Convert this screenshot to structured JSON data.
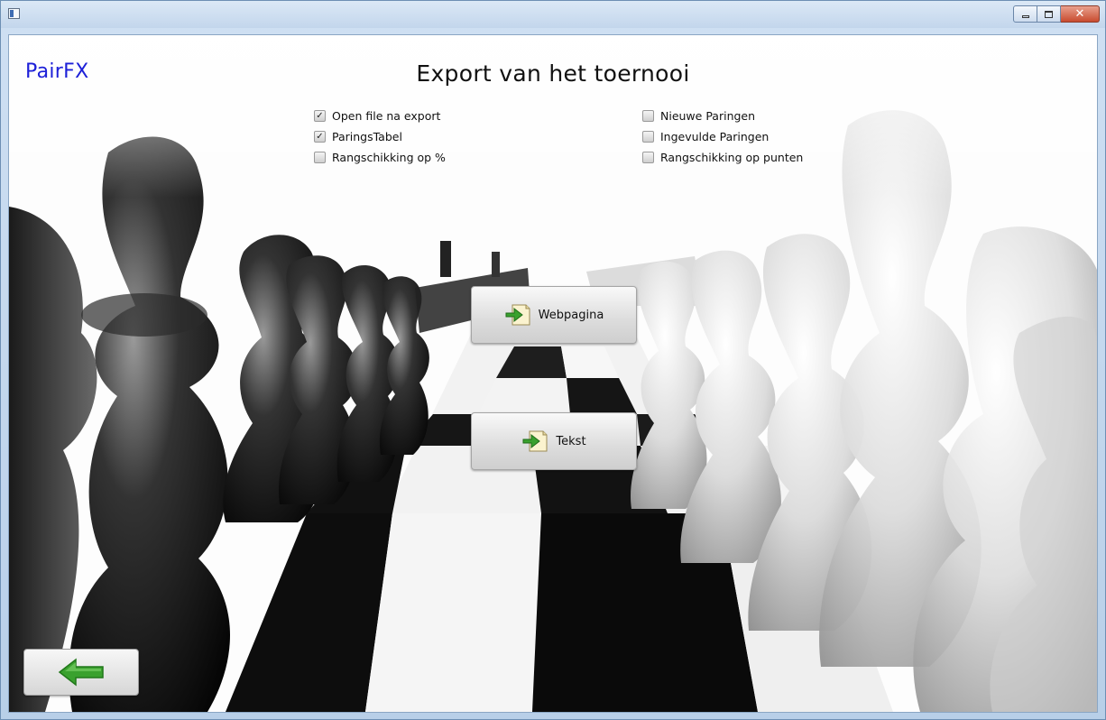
{
  "app": {
    "name": "PairFX"
  },
  "page": {
    "title": "Export van het toernooi"
  },
  "options": {
    "left": [
      {
        "label": "Open file na export",
        "checked": true
      },
      {
        "label": "ParingsTabel",
        "checked": true
      },
      {
        "label": "Rangschikking op %",
        "checked": false
      }
    ],
    "right": [
      {
        "label": "Nieuwe Paringen",
        "checked": false
      },
      {
        "label": "Ingevulde Paringen",
        "checked": false
      },
      {
        "label": "Rangschikking op punten",
        "checked": false
      }
    ]
  },
  "actions": {
    "webpage_label": "Webpagina",
    "text_label": "Tekst"
  },
  "icons": {
    "export": "export-document-icon",
    "back": "back-arrow-icon",
    "check_glyph": "✓"
  },
  "colors": {
    "brand": "#1d20d8",
    "arrow_green": "#3aa12e"
  }
}
